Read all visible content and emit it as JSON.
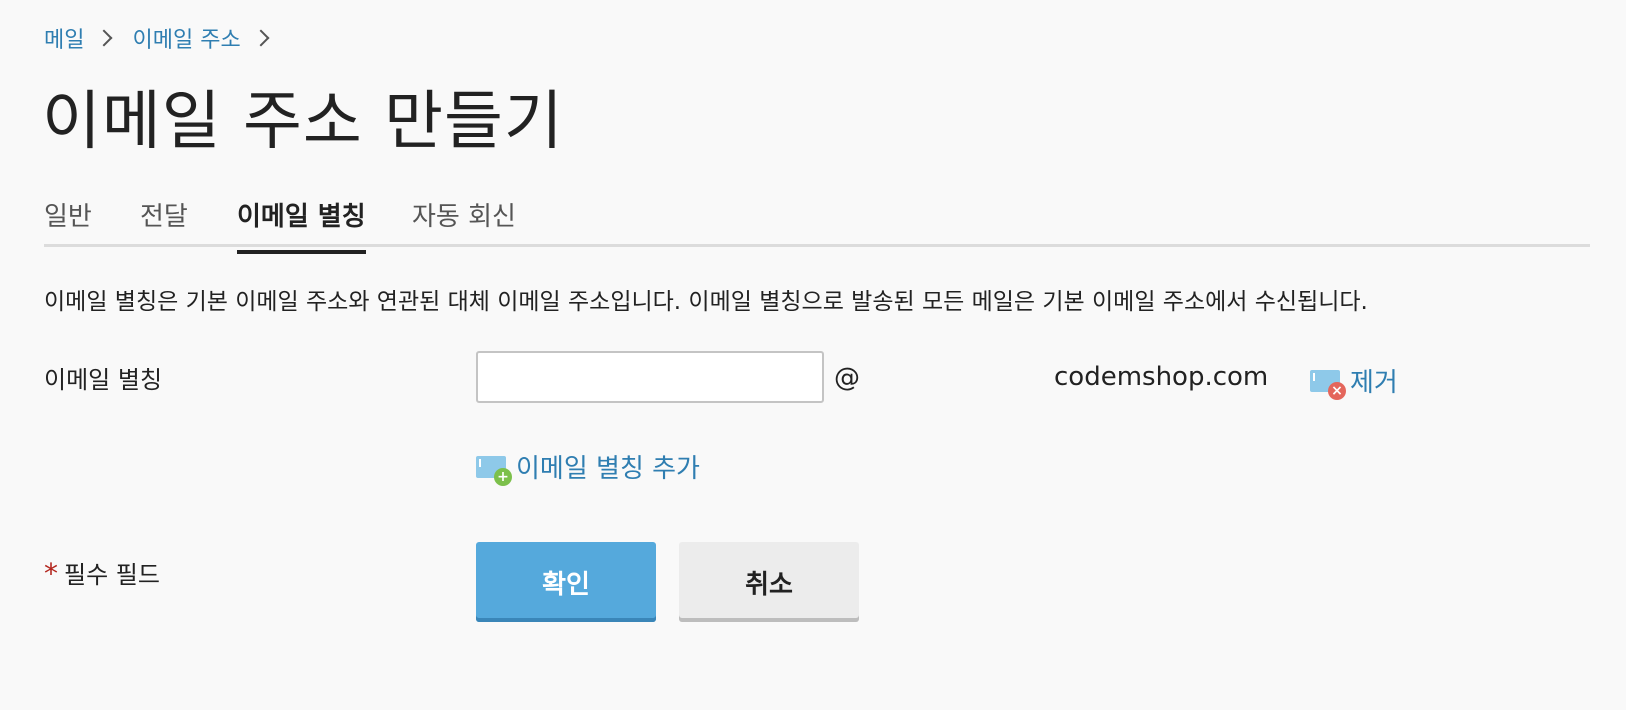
{
  "breadcrumb": {
    "items": [
      "메일",
      "이메일 주소"
    ]
  },
  "page": {
    "title": "이메일 주소 만들기"
  },
  "tabs": [
    {
      "label": "일반",
      "active": false
    },
    {
      "label": "전달",
      "active": false
    },
    {
      "label": "이메일 별칭",
      "active": true
    },
    {
      "label": "자동 회신",
      "active": false
    }
  ],
  "description": "이메일 별칭은 기본 이메일 주소와 연관된 대체 이메일 주소입니다. 이메일 별칭으로 발송된 모든 메일은 기본 이메일 주소에서 수신됩니다.",
  "form": {
    "alias_label": "이메일 별칭",
    "alias_value": "",
    "at_sign": "@",
    "domain": "codemshop.com",
    "remove_label": "제거",
    "add_alias_label": "이메일 별칭 추가",
    "required_star": "*",
    "required_label": "필수 필드"
  },
  "buttons": {
    "ok_label": "확인",
    "cancel_label": "취소"
  },
  "icons": {
    "remove": "remove-alias-icon",
    "add": "add-alias-icon"
  },
  "colors": {
    "link": "#2f7eb1",
    "primary_button": "#55a9dc",
    "required_star": "#b3261e"
  }
}
